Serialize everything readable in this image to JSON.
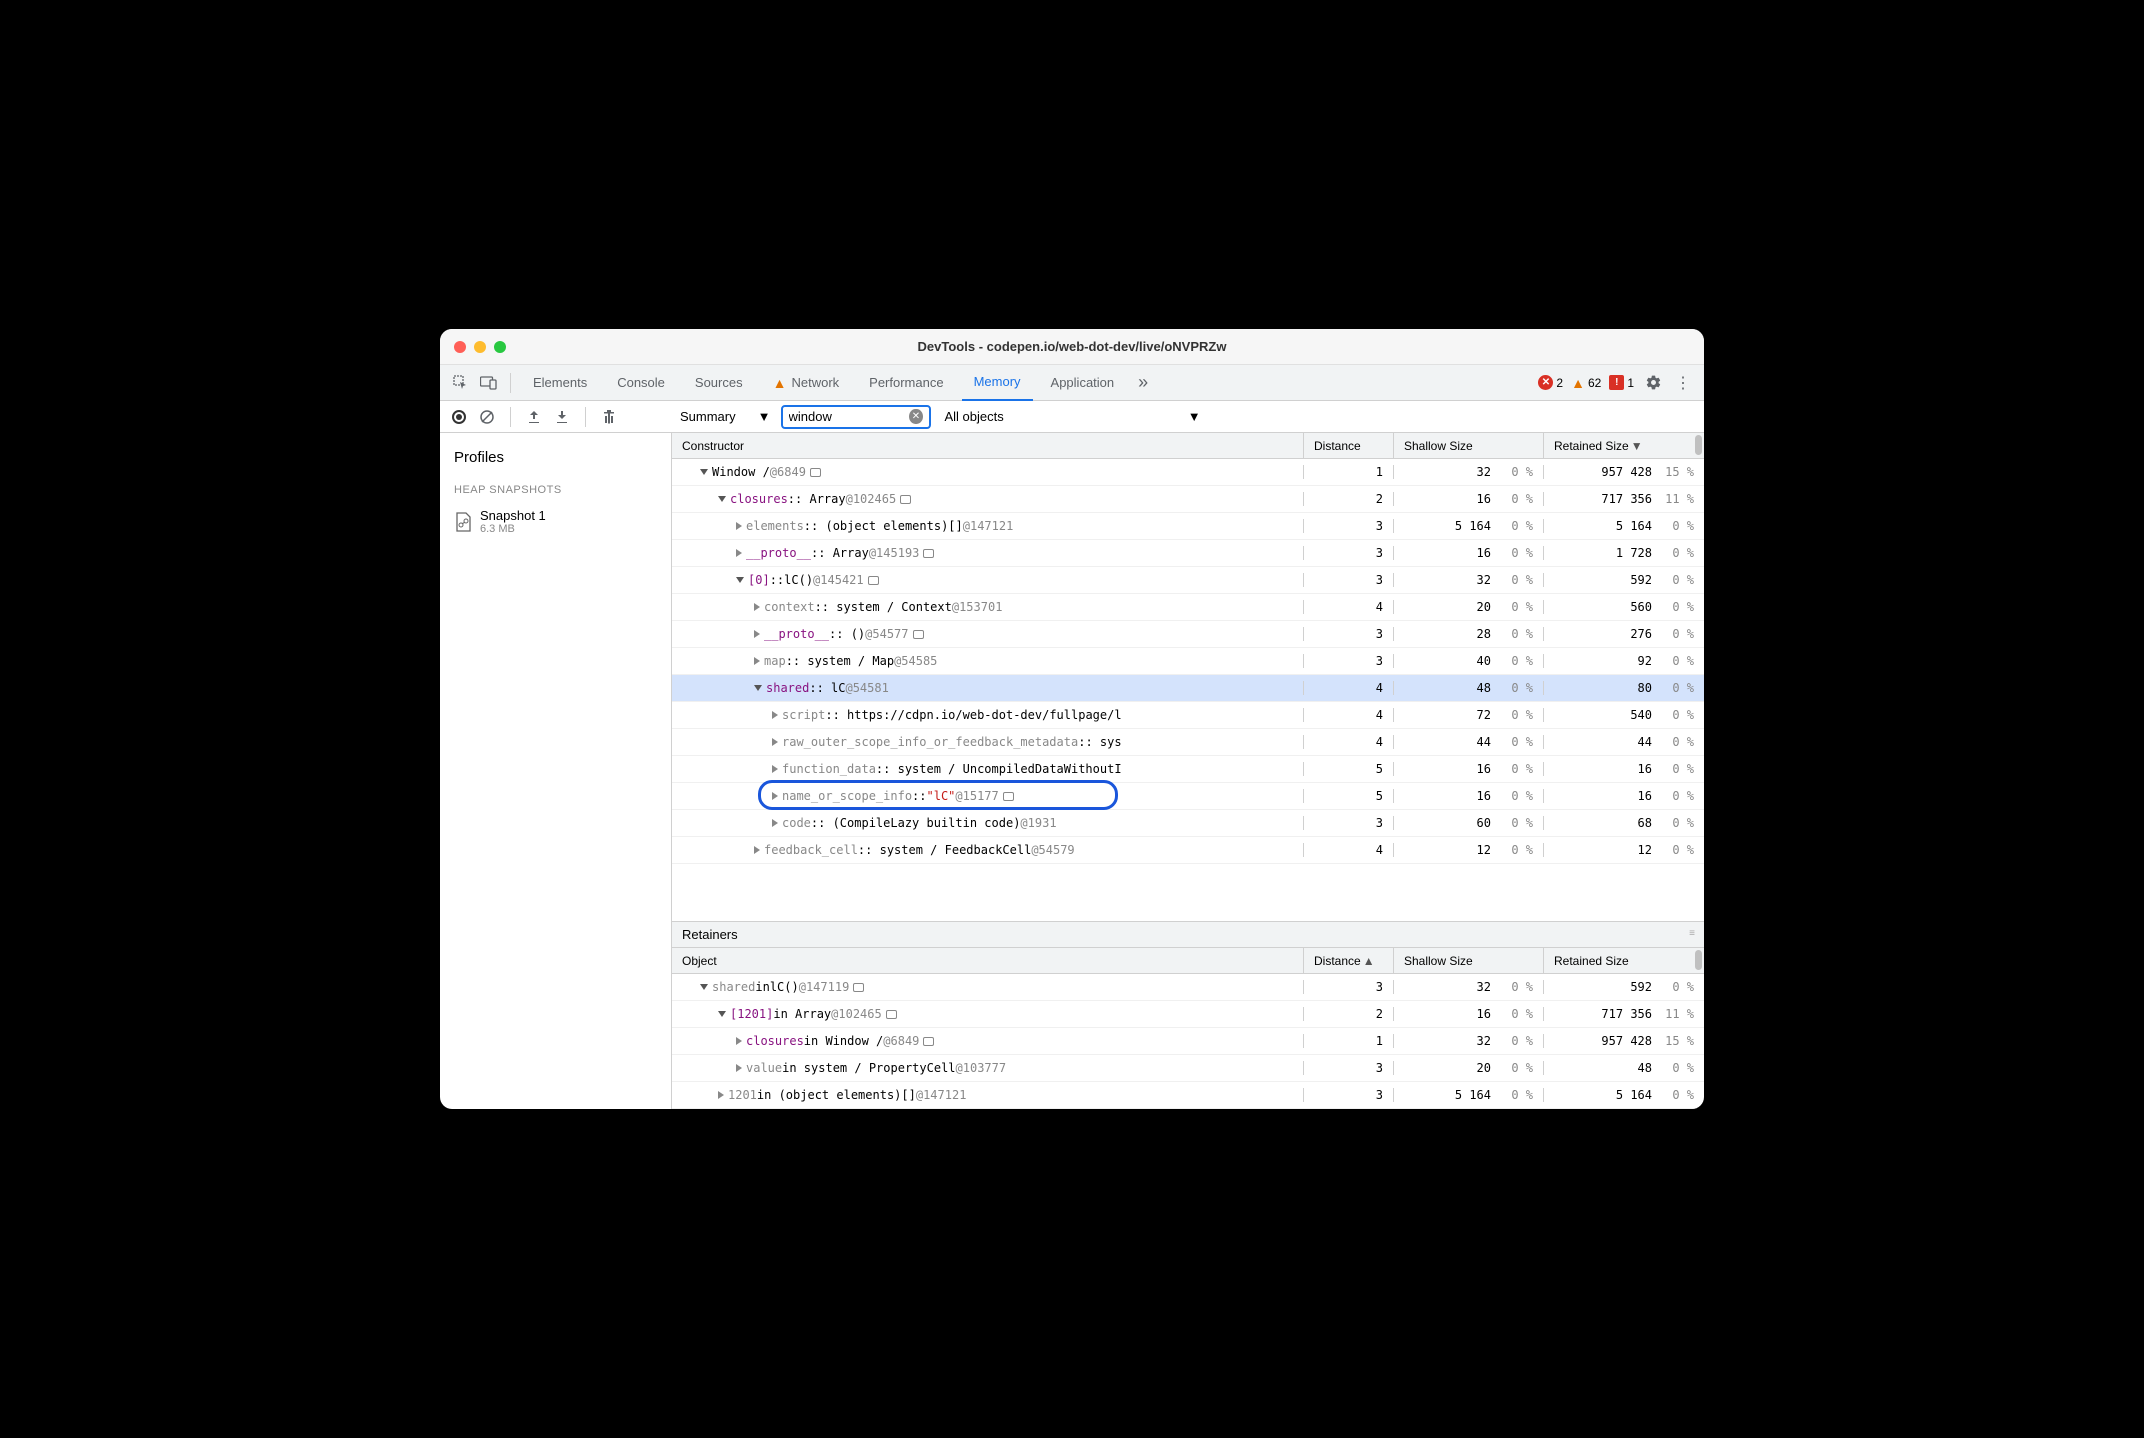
{
  "window": {
    "title": "DevTools - codepen.io/web-dot-dev/live/oNVPRZw"
  },
  "tabs": [
    {
      "label": "Elements",
      "active": false
    },
    {
      "label": "Console",
      "active": false
    },
    {
      "label": "Sources",
      "active": false
    },
    {
      "label": "Network",
      "active": false,
      "warn": true
    },
    {
      "label": "Performance",
      "active": false
    },
    {
      "label": "Memory",
      "active": true
    },
    {
      "label": "Application",
      "active": false
    }
  ],
  "counts": {
    "errors": "2",
    "warnings": "62",
    "issues": "1"
  },
  "toolbar": {
    "view": "Summary",
    "filter": "window",
    "scope": "All objects"
  },
  "sidebar": {
    "title": "Profiles",
    "section": "HEAP SNAPSHOTS",
    "snapshot": {
      "name": "Snapshot 1",
      "size": "6.3 MB"
    }
  },
  "headers": {
    "main": [
      "Constructor",
      "Distance",
      "Shallow Size",
      "Retained Size"
    ],
    "retainers": "Retainers",
    "retcols": [
      "Object",
      "Distance",
      "Shallow Size",
      "Retained Size"
    ]
  },
  "rows": [
    {
      "indent": 1,
      "tri": "down",
      "parts": [
        [
          "",
          "Window / "
        ],
        [
          "grey",
          "  @6849"
        ]
      ],
      "popout": true,
      "d": "1",
      "s": "32",
      "sp": "0 %",
      "r": "957 428",
      "rp": "15 %"
    },
    {
      "indent": 2,
      "tri": "down",
      "parts": [
        [
          "purple",
          "closures"
        ],
        [
          "",
          " :: Array "
        ],
        [
          "grey",
          "@102465"
        ]
      ],
      "popout": true,
      "d": "2",
      "s": "16",
      "sp": "0 %",
      "r": "717 356",
      "rp": "11 %"
    },
    {
      "indent": 3,
      "tri": "right",
      "parts": [
        [
          "grey",
          "elements"
        ],
        [
          "",
          " :: (object elements)[] "
        ],
        [
          "grey",
          "@147121"
        ]
      ],
      "d": "3",
      "s": "5 164",
      "sp": "0 %",
      "r": "5 164",
      "rp": "0 %"
    },
    {
      "indent": 3,
      "tri": "right",
      "parts": [
        [
          "purple",
          "__proto__"
        ],
        [
          "",
          " :: Array "
        ],
        [
          "grey",
          "@145193"
        ]
      ],
      "popout": true,
      "d": "3",
      "s": "16",
      "sp": "0 %",
      "r": "1 728",
      "rp": "0 %"
    },
    {
      "indent": 3,
      "tri": "down",
      "parts": [
        [
          "purple",
          "[0]"
        ],
        [
          "",
          " :: "
        ],
        [
          "",
          "lC()"
        ],
        [
          "grey",
          " @145421"
        ]
      ],
      "popout": true,
      "d": "3",
      "s": "32",
      "sp": "0 %",
      "r": "592",
      "rp": "0 %"
    },
    {
      "indent": 4,
      "tri": "right",
      "parts": [
        [
          "grey",
          "context"
        ],
        [
          "",
          " :: system / Context "
        ],
        [
          "grey",
          "@153701"
        ]
      ],
      "d": "4",
      "s": "20",
      "sp": "0 %",
      "r": "560",
      "rp": "0 %"
    },
    {
      "indent": 4,
      "tri": "right",
      "parts": [
        [
          "purple",
          "__proto__"
        ],
        [
          "",
          " :: () "
        ],
        [
          "grey",
          "@54577"
        ]
      ],
      "popout": true,
      "d": "3",
      "s": "28",
      "sp": "0 %",
      "r": "276",
      "rp": "0 %"
    },
    {
      "indent": 4,
      "tri": "right",
      "parts": [
        [
          "grey",
          "map"
        ],
        [
          "",
          " :: system / Map "
        ],
        [
          "grey",
          "@54585"
        ]
      ],
      "d": "3",
      "s": "40",
      "sp": "0 %",
      "r": "92",
      "rp": "0 %"
    },
    {
      "indent": 4,
      "tri": "down",
      "selected": true,
      "parts": [
        [
          "purple",
          "shared"
        ],
        [
          "",
          " :: lC "
        ],
        [
          "grey",
          "@54581"
        ]
      ],
      "d": "4",
      "s": "48",
      "sp": "0 %",
      "r": "80",
      "rp": "0 %"
    },
    {
      "indent": 5,
      "tri": "right",
      "parts": [
        [
          "grey",
          "script"
        ],
        [
          "",
          " :: https://cdpn.io/web-dot-dev/fullpage/l"
        ]
      ],
      "d": "4",
      "s": "72",
      "sp": "0 %",
      "r": "540",
      "rp": "0 %"
    },
    {
      "indent": 5,
      "tri": "right",
      "parts": [
        [
          "grey",
          "raw_outer_scope_info_or_feedback_metadata"
        ],
        [
          "",
          " :: sys"
        ]
      ],
      "d": "4",
      "s": "44",
      "sp": "0 %",
      "r": "44",
      "rp": "0 %"
    },
    {
      "indent": 5,
      "tri": "right",
      "parts": [
        [
          "grey",
          "function_data"
        ],
        [
          "",
          " :: system / UncompiledDataWithoutI"
        ]
      ],
      "d": "5",
      "s": "16",
      "sp": "0 %",
      "r": "16",
      "rp": "0 %"
    },
    {
      "indent": 5,
      "tri": "right",
      "highlight": true,
      "parts": [
        [
          "grey",
          "name_or_scope_info"
        ],
        [
          "",
          " :: "
        ],
        [
          "red",
          "\"lC\""
        ],
        [
          "grey",
          " @15177"
        ]
      ],
      "popout": true,
      "d": "5",
      "s": "16",
      "sp": "0 %",
      "r": "16",
      "rp": "0 %"
    },
    {
      "indent": 5,
      "tri": "right",
      "parts": [
        [
          "grey",
          "code"
        ],
        [
          "",
          " :: (CompileLazy builtin code) "
        ],
        [
          "grey",
          "@1931"
        ]
      ],
      "d": "3",
      "s": "60",
      "sp": "0 %",
      "r": "68",
      "rp": "0 %"
    },
    {
      "indent": 4,
      "tri": "right",
      "parts": [
        [
          "grey",
          "feedback_cell"
        ],
        [
          "",
          " :: system / FeedbackCell "
        ],
        [
          "grey",
          "@54579"
        ]
      ],
      "d": "4",
      "s": "12",
      "sp": "0 %",
      "r": "12",
      "rp": "0 %"
    }
  ],
  "retainers": [
    {
      "indent": 1,
      "tri": "down",
      "parts": [
        [
          "grey",
          "shared"
        ],
        [
          "",
          " in "
        ],
        [
          "",
          "lC()"
        ],
        [
          "grey",
          " @147119"
        ]
      ],
      "popout": true,
      "d": "3",
      "s": "32",
      "sp": "0 %",
      "r": "592",
      "rp": "0 %"
    },
    {
      "indent": 2,
      "tri": "down",
      "parts": [
        [
          "purple",
          "[1201]"
        ],
        [
          "",
          " in Array "
        ],
        [
          "grey",
          "@102465"
        ]
      ],
      "popout": true,
      "d": "2",
      "s": "16",
      "sp": "0 %",
      "r": "717 356",
      "rp": "11 %"
    },
    {
      "indent": 3,
      "tri": "right",
      "parts": [
        [
          "purple",
          "closures"
        ],
        [
          "",
          " in Window /   "
        ],
        [
          "grey",
          "@6849"
        ]
      ],
      "popout": true,
      "d": "1",
      "s": "32",
      "sp": "0 %",
      "r": "957 428",
      "rp": "15 %"
    },
    {
      "indent": 3,
      "tri": "right",
      "parts": [
        [
          "grey",
          "value"
        ],
        [
          "",
          " in system / PropertyCell "
        ],
        [
          "grey",
          "@103777"
        ]
      ],
      "d": "3",
      "s": "20",
      "sp": "0 %",
      "r": "48",
      "rp": "0 %"
    },
    {
      "indent": 2,
      "tri": "right",
      "parts": [
        [
          "grey",
          "1201"
        ],
        [
          "",
          " in (object elements)[] "
        ],
        [
          "grey",
          "@147121"
        ]
      ],
      "d": "3",
      "s": "5 164",
      "sp": "0 %",
      "r": "5 164",
      "rp": "0 %"
    }
  ]
}
